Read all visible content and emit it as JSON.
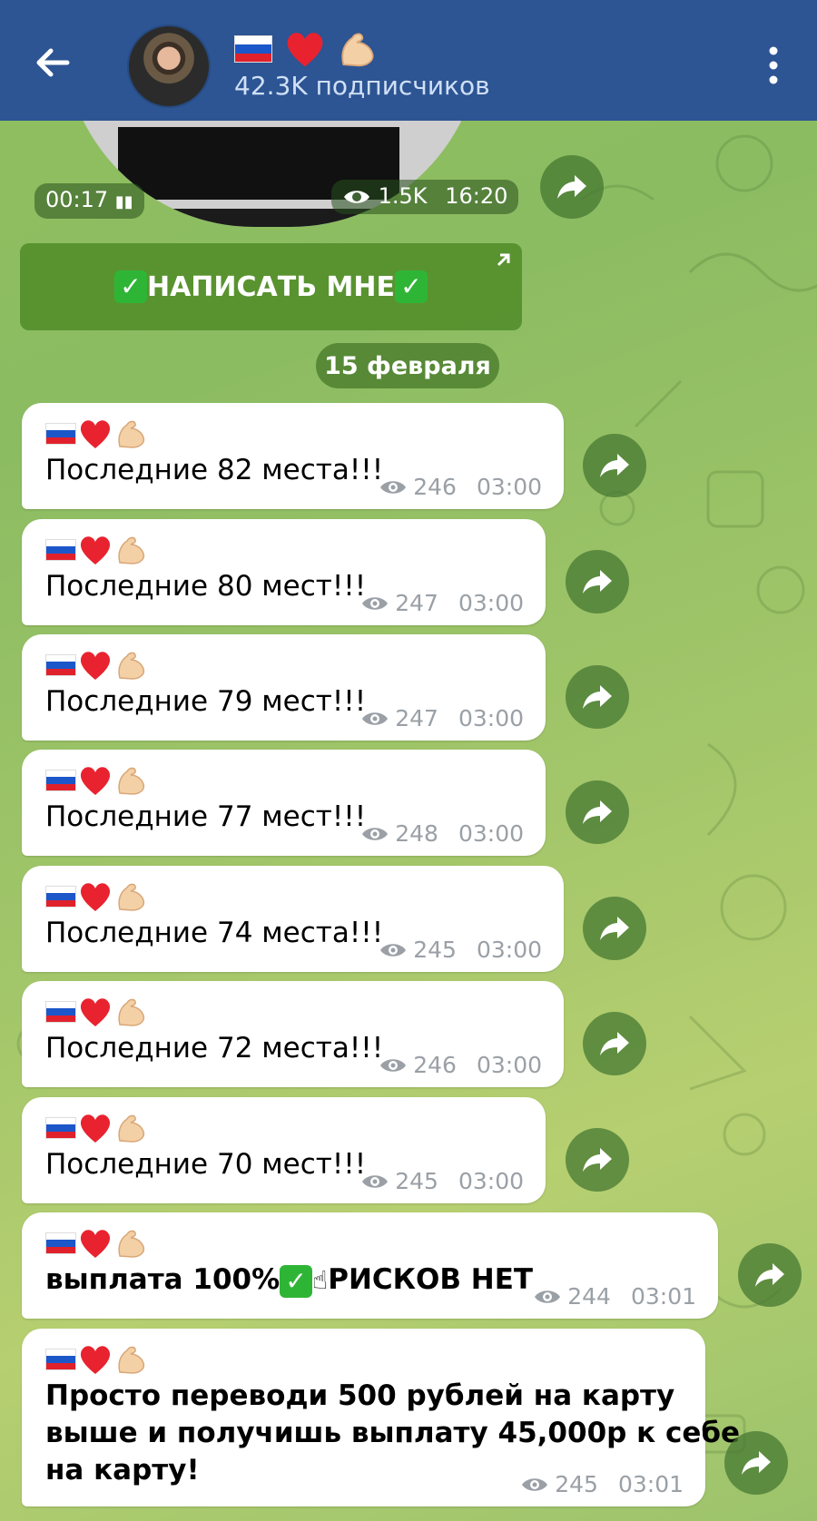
{
  "header": {
    "title_emojis": [
      "russia-flag",
      "red-heart",
      "flexed-biceps"
    ],
    "subtitle": "42.3K подписчиков"
  },
  "video": {
    "duration": "00:17",
    "views": "1.5K",
    "time": "16:20"
  },
  "cta_button": {
    "label": "НАПИСАТЬ МНЕ"
  },
  "date_separator": "15 февраля",
  "messages": [
    {
      "text": "Последние 82 места!!!",
      "views": "246",
      "time": "03:00"
    },
    {
      "text": "Последние 80 мест!!!",
      "views": "247",
      "time": "03:00"
    },
    {
      "text": "Последние 79 мест!!!",
      "views": "247",
      "time": "03:00"
    },
    {
      "text": "Последние 77 мест!!!",
      "views": "248",
      "time": "03:00"
    },
    {
      "text": "Последние 74 места!!!",
      "views": "245",
      "time": "03:00"
    },
    {
      "text": "Последние 72 места!!!",
      "views": "246",
      "time": "03:00"
    },
    {
      "text": "Последние 70 мест!!!",
      "views": "245",
      "time": "03:00"
    },
    {
      "text_a": "выплата 100%",
      "text_b": "РИСКОВ НЕТ",
      "views": "244",
      "time": "03:01"
    },
    {
      "lines": [
        "Просто переводи 500 рублей на карту",
        "выше и получишь выплату 45,000р к себе",
        "на карту!"
      ],
      "views": "245",
      "time": "03:01"
    }
  ],
  "colors": {
    "header_bg": "#2d5493",
    "bubble_bg": "#ffffff",
    "accent_green": "#2fb536",
    "meta_gray": "#9aa0a6"
  }
}
